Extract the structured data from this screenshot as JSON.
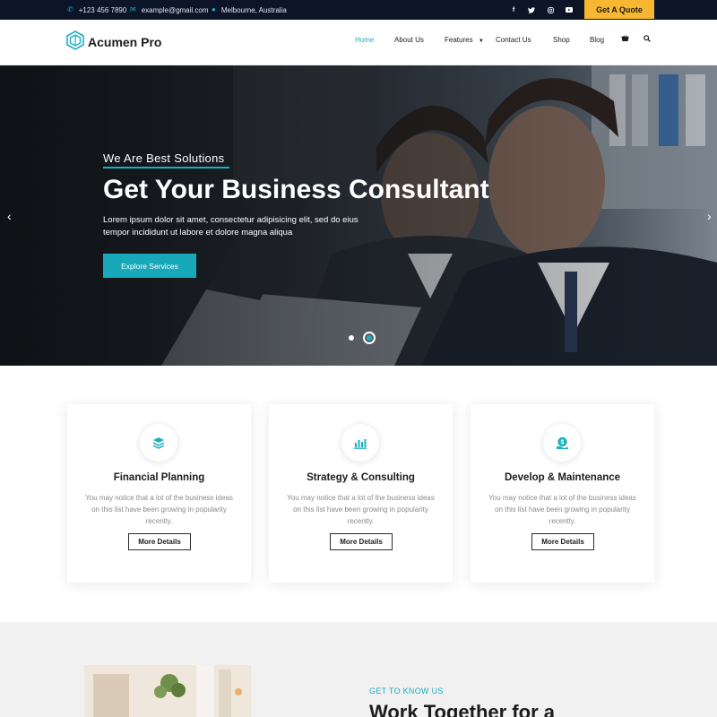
{
  "topbar": {
    "phone": "+123 456 7890",
    "email": "example@gmail.com",
    "location": "Melbourne, Australia",
    "social": [
      "f",
      "t",
      "in",
      "yt"
    ],
    "quote_button": "Get A Quote"
  },
  "header": {
    "logo_text": "Acumen Pro",
    "nav": [
      "Home",
      "About Us",
      "Features",
      "Contact Us",
      "Shop",
      "Blog"
    ],
    "active_nav": "Home"
  },
  "hero": {
    "subtitle": "We Are Best Solutions",
    "title": "Get Your Business Consultant",
    "description": "Lorem ipsum dolor sit amet, consectetur adipisicing elit, sed do eius tempor incididunt ut labore et dolore magna aliqua",
    "button": "Explore Services",
    "slides_total": 2,
    "slide_active": 2
  },
  "services": [
    {
      "icon": "layers-icon",
      "title": "Financial Planning",
      "text": "You may notice that a lot of the business ideas on this list have been growing in popularity recently.",
      "button": "More Details"
    },
    {
      "icon": "chart-icon",
      "title": "Strategy & Consulting",
      "text": "You may notice that a lot of the business ideas on this list have been growing in popularity recently.",
      "button": "More Details"
    },
    {
      "icon": "money-icon",
      "title": "Develop & Maintenance",
      "text": "You may notice that a lot of the business ideas on this list have been growing in popularity recently.",
      "button": "More Details"
    }
  ],
  "about": {
    "kicker": "GET TO KNOW US",
    "title": "Work Together for a"
  },
  "colors": {
    "accent": "#1ab0c0",
    "topbar_bg": "#0c1528",
    "quote_button": "#f7b731"
  }
}
